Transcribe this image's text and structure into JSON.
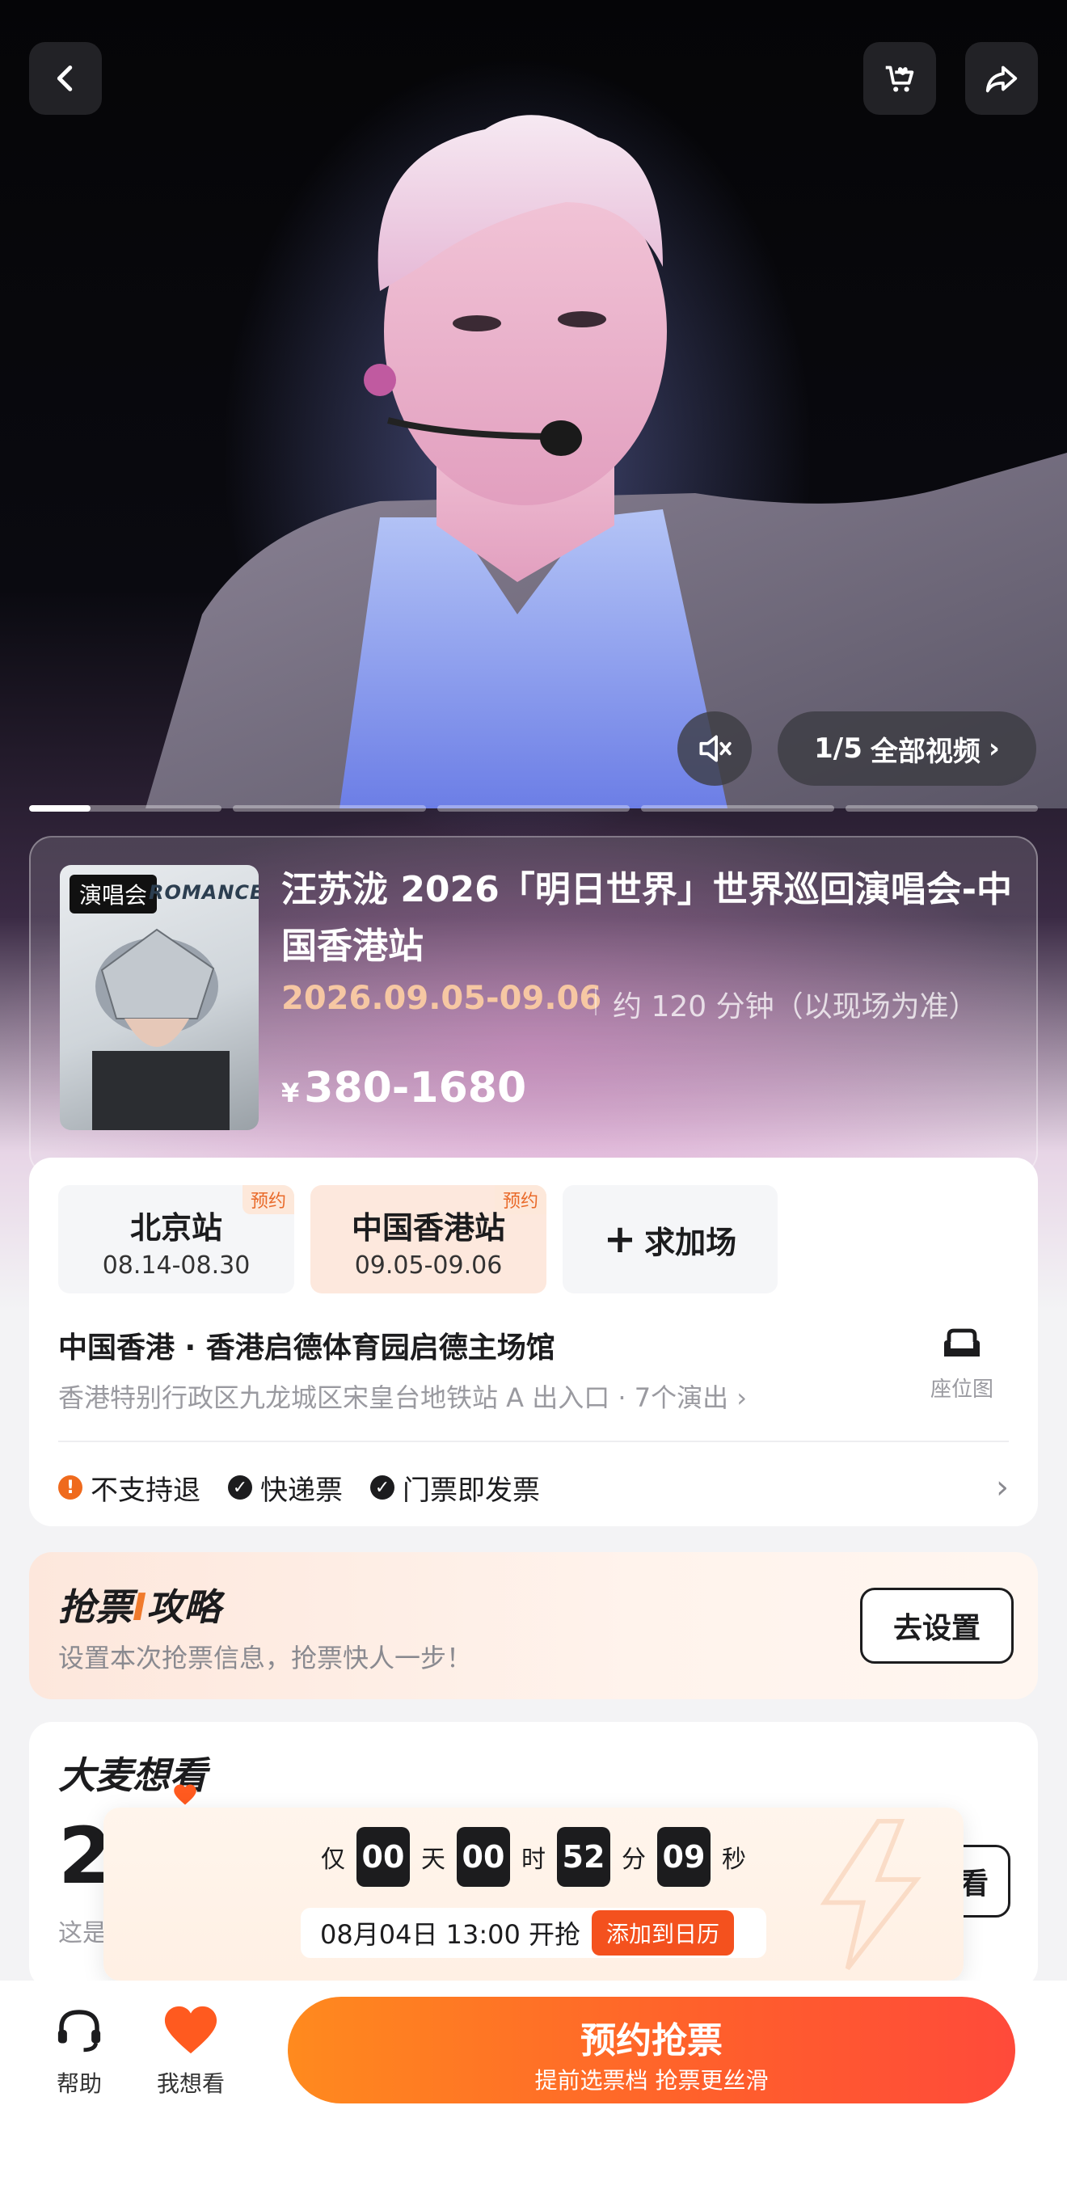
{
  "hero": {
    "video_counter": "1/5",
    "video_label": "全部视频",
    "slides_total": 5,
    "slide_progress": 0.32
  },
  "event": {
    "category_tag": "演唱会",
    "poster_brand": "ROMANCE",
    "title": "汪苏泷 2026「明日世界」世界巡回演唱会-中国香港站",
    "date_range": "2026.09.05-09.06",
    "duration": "约 120 分钟（以现场为准）",
    "currency": "¥",
    "price_range": "380-1680"
  },
  "cities": [
    {
      "name": "北京站",
      "dates": "08.14-08.30",
      "badge": "预约"
    },
    {
      "name": "中国香港站",
      "dates": "09.05-09.06",
      "badge": "预约"
    }
  ],
  "add_show_label": "求加场",
  "venue": {
    "name": "中国香港 · 香港启德体育园启德主场馆",
    "address": "香港特别行政区九龙城区宋皇台地铁站 A 出入口 · 7个演出 ›",
    "seat_map_label": "座位图"
  },
  "policies": [
    {
      "label": "不支持退",
      "icon": "exclamation-icon"
    },
    {
      "label": "快递票",
      "icon": "check-icon"
    },
    {
      "label": "门票即发票",
      "icon": "check-icon"
    }
  ],
  "strategy": {
    "title_a": "抢票",
    "title_hi": "I",
    "title_b": "攻略",
    "subtitle": "设置本次抢票信息，抢票快人一步！",
    "button": "去设置"
  },
  "want": {
    "title": "大麦想看",
    "count": "2",
    "subtitle": "这是",
    "button": "看"
  },
  "countdown": {
    "prefix": "仅",
    "days": "00",
    "days_unit": "天",
    "hours": "00",
    "hours_unit": "时",
    "minutes": "52",
    "minutes_unit": "分",
    "seconds": "09",
    "seconds_unit": "秒",
    "open_time": "08月04日 13:00 开抢",
    "calendar_button": "添加到日历"
  },
  "bottom": {
    "help_label": "帮助",
    "want_label": "我想看",
    "reserve_main": "预约抢票",
    "reserve_sub": "提前选票档 抢票更丝滑"
  },
  "colors": {
    "accent_orange": "#ff5e2c",
    "date_peach": "#f6c7a3",
    "heart": "#ff5a1f"
  }
}
